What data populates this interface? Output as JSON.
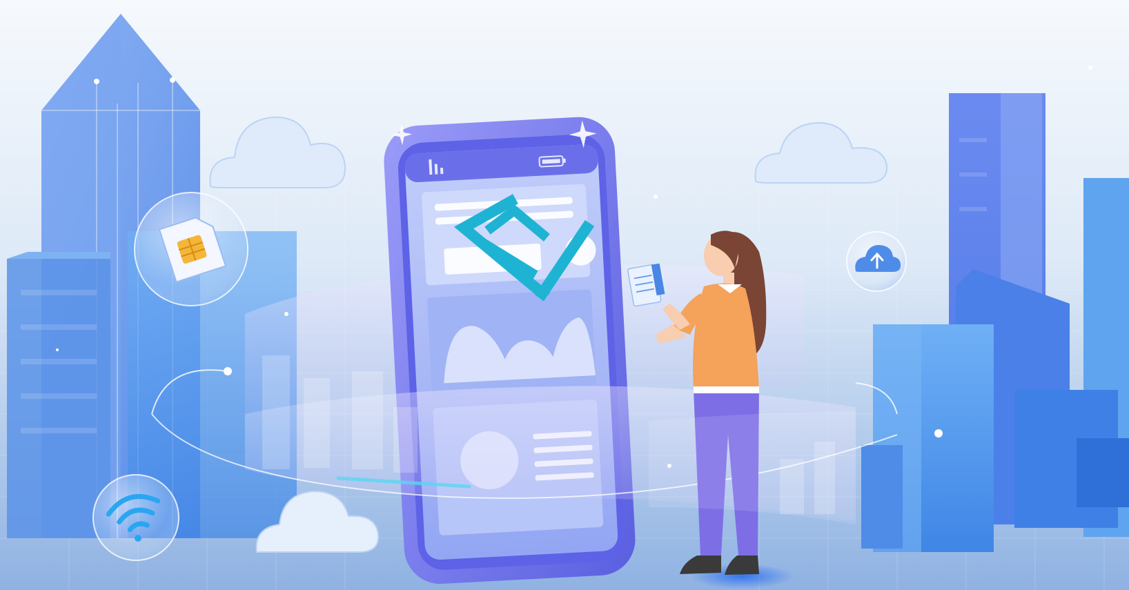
{
  "scene": {
    "palette": {
      "sky_top": "#f4f8fd",
      "sky_bottom": "#9fc0e6",
      "building_dark": "#4a6fe0",
      "building_mid": "#5e92ea",
      "building_light": "#8ab7f3",
      "phone_frame": "#7b7cf0",
      "phone_screen": "#a9b9f7",
      "panel": "#cfd9fb",
      "logo": "#1fb3d3",
      "cloud": "#dfeafb",
      "ring_glass": "#d9d2f8",
      "shirt": "#f5a25a",
      "pants": "#7d6ee6",
      "hair": "#7a4535"
    },
    "icons": [
      "sim-card-icon",
      "wifi-icon",
      "cloud-upload-icon",
      "checkmark-logo-icon",
      "signal-icon",
      "battery-icon"
    ]
  }
}
